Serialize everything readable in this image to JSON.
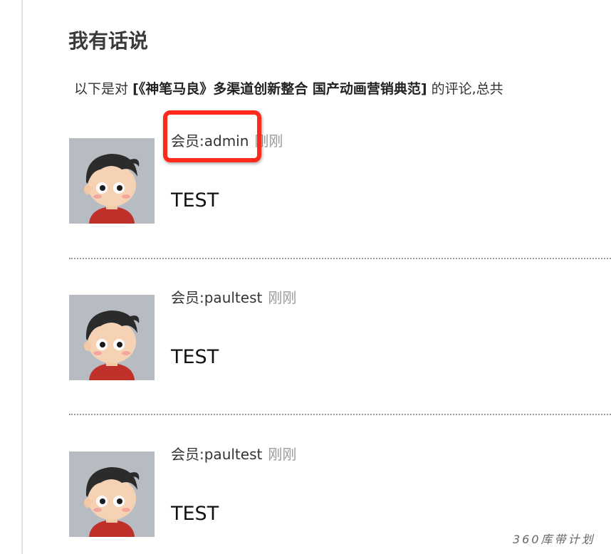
{
  "section": {
    "heading": "我有话说",
    "intro_prefix": "以下是对",
    "intro_article": "[《神笔马良》多渠道创新整合 国产动画营销典范]",
    "intro_suffix": "的评论,总共"
  },
  "comments": [
    {
      "member": "会员:admin",
      "time": "刚刚",
      "body": "TEST",
      "avatar": "cartoon-boy-avatar"
    },
    {
      "member": "会员:paultest",
      "time": "刚刚",
      "body": "TEST",
      "avatar": "cartoon-boy-avatar"
    },
    {
      "member": "会员:paultest",
      "time": "刚刚",
      "body": "TEST",
      "avatar": "cartoon-boy-avatar"
    }
  ],
  "annotation": {
    "color": "#ff2a1a"
  },
  "watermark": "360库带计划"
}
